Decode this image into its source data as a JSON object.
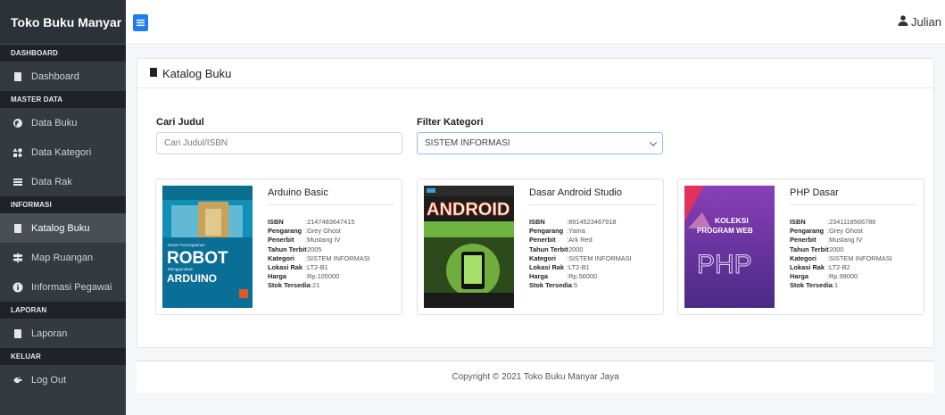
{
  "app": {
    "brand": "Toko Buku Manyar"
  },
  "sidebar": {
    "sections": [
      {
        "title": "DASHBOARD",
        "items": [
          {
            "label": "Dashboard",
            "icon": "book-icon"
          }
        ]
      },
      {
        "title": "MASTER DATA",
        "items": [
          {
            "label": "Data Buku",
            "icon": "globe-icon"
          },
          {
            "label": "Data Kategori",
            "icon": "shapes-icon"
          },
          {
            "label": "Data Rak",
            "icon": "bars-icon"
          }
        ]
      },
      {
        "title": "INFORMASI",
        "items": [
          {
            "label": "Katalog Buku",
            "icon": "book-icon",
            "active": true
          },
          {
            "label": "Map Ruangan",
            "icon": "signs-icon"
          },
          {
            "label": "Informasi Pegawai",
            "icon": "info-icon"
          }
        ]
      },
      {
        "title": "LAPORAN",
        "items": [
          {
            "label": "Laporan",
            "icon": "book-icon"
          }
        ]
      },
      {
        "title": "KELUAR",
        "items": [
          {
            "label": "Log Out",
            "icon": "hand-icon"
          }
        ]
      }
    ]
  },
  "topbar": {
    "user_name": "Julian"
  },
  "page": {
    "title": "Katalog Buku",
    "search": {
      "label": "Cari Judul",
      "placeholder": "Cari Judul/ISBN"
    },
    "filter": {
      "label": "Filter Kategori",
      "value": "SISTEM INFORMASI"
    }
  },
  "labels": {
    "isbn": "ISBN",
    "pengarang": "Pengarang",
    "penerbit": "Penerbit",
    "tahun": "Tahun Terbit",
    "kategori": "Kategori",
    "rak": "Lokasi Rak",
    "harga": "Harga",
    "stok": "Stok Tersedia"
  },
  "books": [
    {
      "title": "Arduino Basic",
      "isbn": "2147483647415",
      "pengarang": "Grey Ghost",
      "penerbit": "Mustang IV",
      "tahun": "2005",
      "kategori": "SISTEM INFORMASI",
      "rak": "LT2-B1",
      "harga": "Rp.105000",
      "stok": "21",
      "cover": {
        "line1": "Dasar Pemrograman",
        "line2": "ROBOT",
        "line3": "Menggunakan",
        "line4": "ARDUINO"
      }
    },
    {
      "title": "Dasar Android Studio",
      "isbn": "8914523467918",
      "pengarang": "Yama",
      "penerbit": "Ark Red",
      "tahun": "2000",
      "kategori": "SISTEM INFORMASI",
      "rak": "LT2-B1",
      "harga": "Rp.56000",
      "stok": "5",
      "cover": {
        "line1": "ANDROID"
      }
    },
    {
      "title": "PHP Dasar",
      "isbn": "2341118566786",
      "pengarang": "Grey Ghost",
      "penerbit": "Mustang IV",
      "tahun": "2000",
      "kategori": "SISTEM INFORMASI",
      "rak": "LT2-B2",
      "harga": "Rp.99000",
      "stok": "1",
      "cover": {
        "line1": "KOLEKSI",
        "line2": "PROGRAM WEB",
        "line3": "PHP"
      }
    }
  ],
  "footer": {
    "text": "Copyright © 2021 Toko Buku Manyar Jaya"
  }
}
